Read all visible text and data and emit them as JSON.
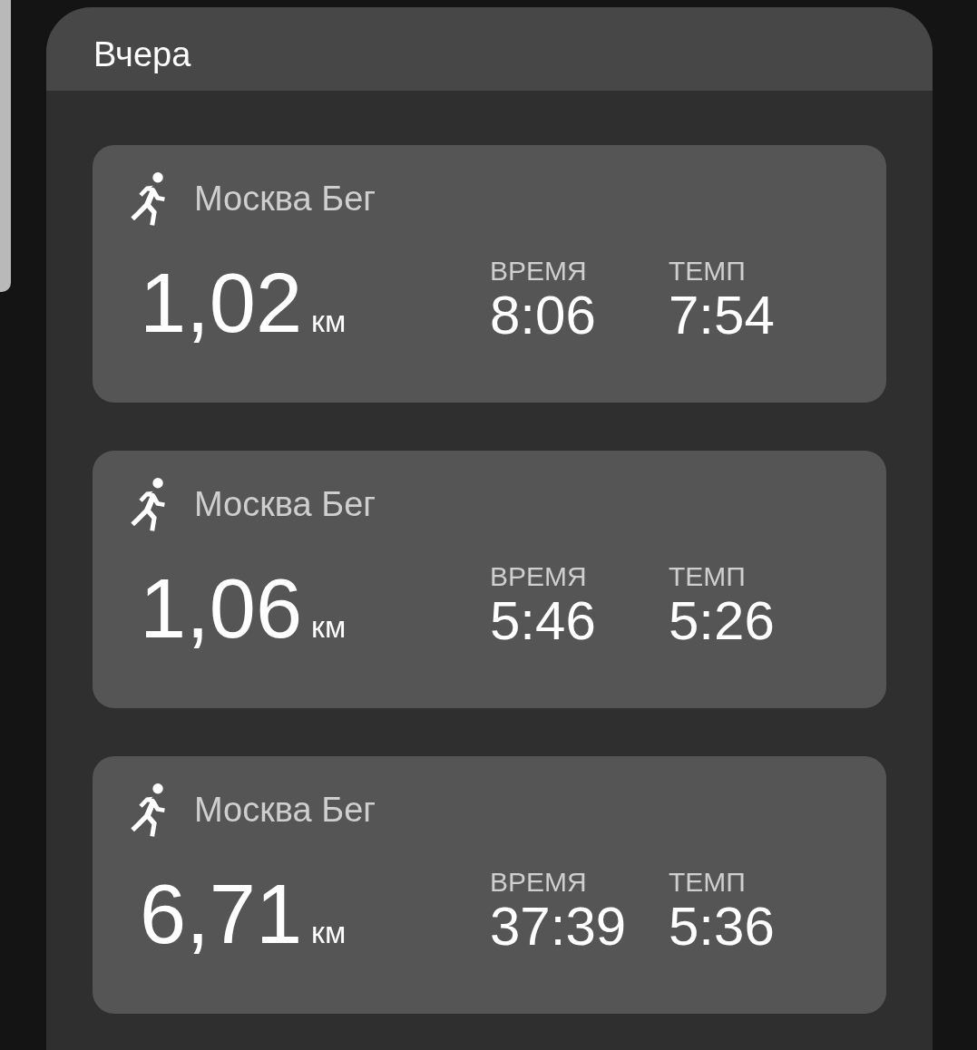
{
  "header": {
    "title": "Вчера"
  },
  "activities": [
    {
      "title": "Москва Бег",
      "distance": "1,02",
      "unit": "км",
      "stats": [
        {
          "label": "ВРЕМЯ",
          "value": "8:06"
        },
        {
          "label": "ТЕМП",
          "value": "7:54"
        }
      ]
    },
    {
      "title": "Москва Бег",
      "distance": "1,06",
      "unit": "км",
      "stats": [
        {
          "label": "ВРЕМЯ",
          "value": "5:46"
        },
        {
          "label": "ТЕМП",
          "value": "5:26"
        }
      ]
    },
    {
      "title": "Москва Бег",
      "distance": "6,71",
      "unit": "км",
      "stats": [
        {
          "label": "ВРЕМЯ",
          "value": "37:39"
        },
        {
          "label": "ТЕМП",
          "value": "5:36"
        }
      ]
    }
  ]
}
